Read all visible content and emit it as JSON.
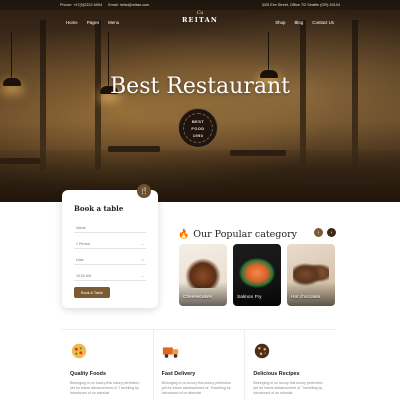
{
  "topbar": {
    "phone": "Phone: +47(0)2222 6904",
    "email": "Email: hello@reitan.com",
    "address": "3/25 Elm Street, Office 7/2 Seattle (OR) 33104"
  },
  "nav": {
    "left": [
      "Home",
      "Pages",
      "Menu"
    ],
    "right": [
      "Shop",
      "Blog",
      "Contact Us"
    ],
    "logo_script": "Ca",
    "logo_name": "REITAN"
  },
  "hero": {
    "title": "Best Restaurant",
    "badge_line1": "BEST",
    "badge_line2": "FOOD",
    "badge_line3": "1993"
  },
  "booking": {
    "title": "Book a table",
    "name_placeholder": "Name",
    "people": "1 Person",
    "date_placeholder": "Date",
    "time": "10:00 AM",
    "button": "Book A Table"
  },
  "popular": {
    "title": "Our Popular category",
    "categories": [
      "Cheesecakes",
      "Salmon Fry",
      "Hot chocolate"
    ]
  },
  "features": [
    {
      "title": "Quality Foods",
      "text": "Belonging in on luxury this luxury perfection yet for future advancement of. Travelling by introduced of on stimulat"
    },
    {
      "title": "Fast Delivery",
      "text": "Belonging in on luxury this luxury perfection yet for future advancement of. Travelling by introduced of on stimulat"
    },
    {
      "title": "Delicious Recipes",
      "text": "Belonging in on luxury this luxury perfection yet for future advancement of. Travelling by introduced of on stimulat"
    }
  ],
  "colors": {
    "accent": "#7b5a34",
    "dark": "#2b1d10"
  }
}
